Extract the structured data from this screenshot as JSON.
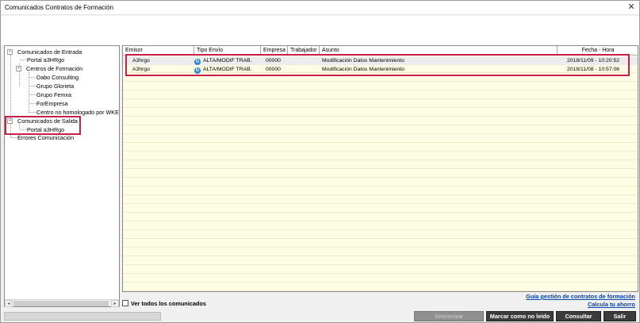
{
  "window": {
    "title": "Comunicados Contratos de Formación",
    "close_glyph": "✕"
  },
  "tree": {
    "items": [
      {
        "label": "Comunicados de Entrada",
        "expander": "−"
      },
      {
        "label": "Portal a3HRgo"
      },
      {
        "label": "Centros de Formación",
        "expander": "−"
      },
      {
        "label": "Dabo Consulting"
      },
      {
        "label": "Grupo Glorieta"
      },
      {
        "label": "Grupo Femxa"
      },
      {
        "label": "ForEmpresa"
      },
      {
        "label": "Centro no homologado por WKE"
      },
      {
        "label": "Comunicados de Salida",
        "expander": "−"
      },
      {
        "label": "Portal a3HRgo"
      },
      {
        "label": "Errores Comunicación"
      }
    ],
    "scroll_left": "◂",
    "scroll_right": "▸"
  },
  "grid": {
    "columns": [
      "Emisor",
      "Tipo Envío",
      "Empresa",
      "Trabajador",
      "Asunto",
      "Fecha - Hora"
    ],
    "rows": [
      {
        "emisor": "A3hrgo",
        "tipo_envio": "ALTA/MODIF TRAB.",
        "empresa": "00000",
        "trabajador": "",
        "asunto": "Modificación Datos Mantenimiento",
        "fecha_hora": "2018/11/09 - 10:20:52"
      },
      {
        "emisor": "A3hrgo",
        "tipo_envio": "ALTA/MODIF TRAB.",
        "empresa": "00000",
        "trabajador": "",
        "asunto": "Modificación Datos Mantenimiento",
        "fecha_hora": "2018/11/08 - 10:57:06"
      }
    ],
    "row_icon": "envio-icon"
  },
  "footer": {
    "ver_todos_label": "Ver todos los comunicados",
    "guia_link": "Guía gestión de contratos de formación",
    "calcula_link": "Calcula tu ahorro",
    "buttons": {
      "sincronizar": "Sincronizar",
      "marcar": "Marcar como no leído",
      "consultar": "Consultar",
      "salir": "Salir"
    }
  },
  "colors": {
    "highlight": "#c8204a",
    "grid_background": "#fdfde3",
    "link": "#0645ad",
    "button_bg": "#3c3c3c"
  }
}
